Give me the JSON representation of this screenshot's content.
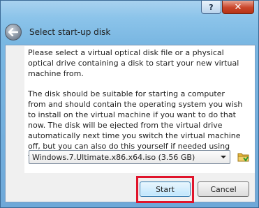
{
  "window": {
    "controls": {
      "help": "?",
      "close": "✕"
    }
  },
  "header": {
    "title": "Select start-up disk"
  },
  "body": {
    "paragraph1": "Please select a virtual optical disk file or a physical optical drive containing a disk to start your new virtual machine from.",
    "paragraph2": "The disk should be suitable for starting a computer from and should contain the operating system you wish to install on the virtual machine if you want to do that now. The disk will be ejected from the virtual drive automatically next time you switch the virtual machine off, but you can also do this yourself if needed using the Devices menu."
  },
  "disk_select": {
    "value": "Windows.7.Ultimate.x86.x64.iso (3.56 GB)"
  },
  "buttons": {
    "start": "Start",
    "cancel": "Cancel"
  },
  "colors": {
    "highlight": "#e0142b",
    "close_button": "#c9452a"
  }
}
